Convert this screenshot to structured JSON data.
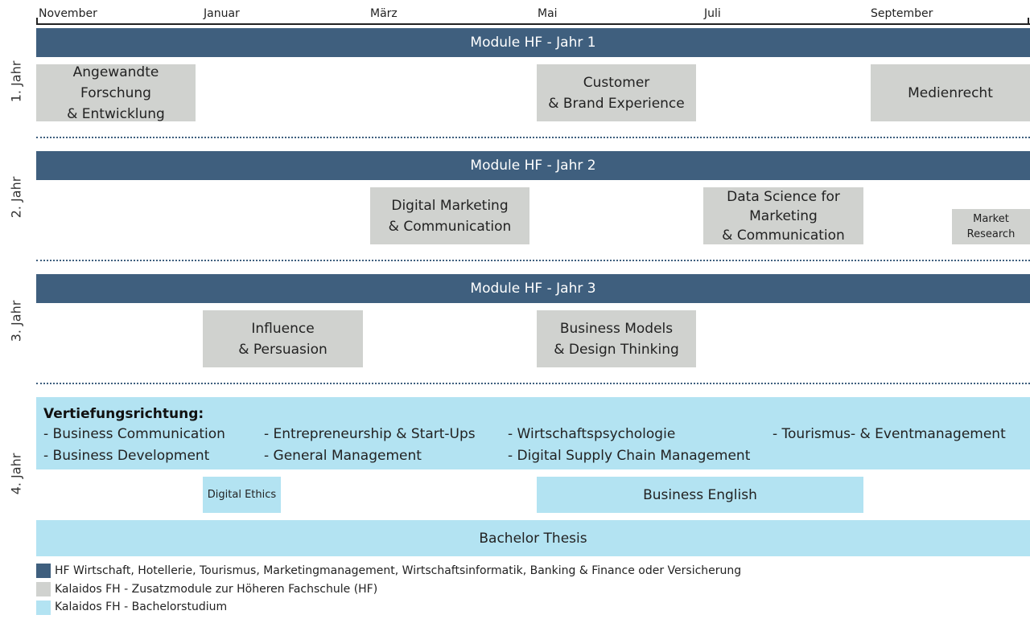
{
  "timeline": {
    "months": [
      "November",
      "Januar",
      "März",
      "Mai",
      "Juli",
      "September"
    ]
  },
  "years": [
    "1. Jahr",
    "2. Jahr",
    "3. Jahr",
    "4. Jahr"
  ],
  "hf_bars": [
    "Module HF - Jahr 1",
    "Module HF - Jahr 2",
    "Module HF - Jahr 3"
  ],
  "modules": {
    "year1": [
      "Angewandte Forschung\n& Entwicklung",
      "Customer\n& Brand Experience",
      "Medienrecht"
    ],
    "year2": [
      "Digital Marketing\n& Communication",
      "Data Science for\nMarketing\n& Communication",
      "Market\nResearch"
    ],
    "year3": [
      "Influence\n& Persuasion",
      "Business Models\n& Design Thinking"
    ]
  },
  "specialization": {
    "title": "Vertiefungsrichtung:",
    "items": [
      "- Business Communication",
      "- Business Development",
      "- Entrepreneurship & Start-Ups",
      "- General Management",
      "- Wirtschaftspsychologie",
      "- Digital Supply Chain Management",
      "- Tourismus- & Eventmanagement"
    ]
  },
  "bachelor": {
    "digital_ethics": "Digital Ethics",
    "business_english": "Business English",
    "thesis": "Bachelor Thesis"
  },
  "legend": [
    {
      "label": "HF Wirtschaft, Hotellerie, Tourismus, Marketingmanagement, Wirtschaftsinformatik, Banking & Finance oder Versicherung",
      "color": "#3f5f7e"
    },
    {
      "label": "Kalaidos FH - Zusatzmodule zur Höheren Fachschule (HF)",
      "color": "#d0d2cf"
    },
    {
      "label": "Kalaidos FH - Bachelorstudium",
      "color": "#b3e3f2"
    }
  ]
}
